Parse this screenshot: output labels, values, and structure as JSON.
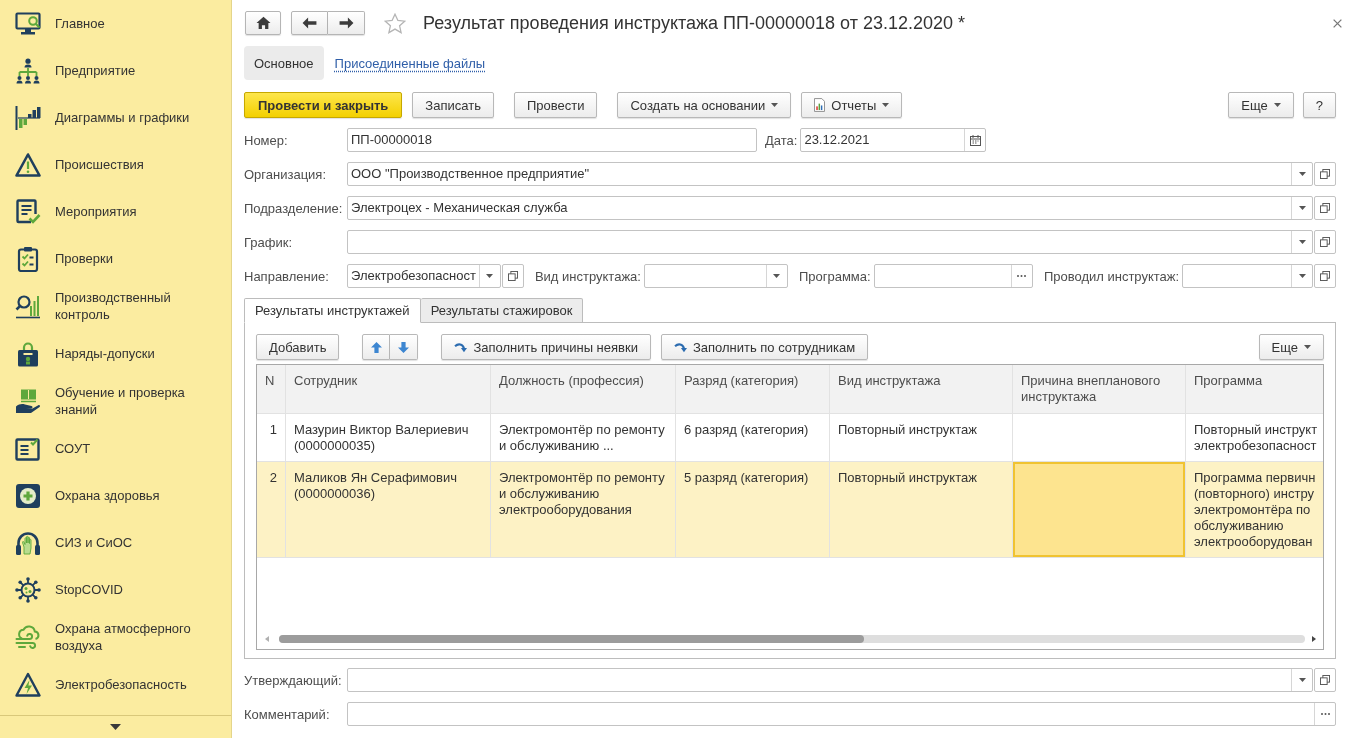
{
  "sidebar": {
    "items": [
      {
        "label": "Главное",
        "selected": false
      },
      {
        "label": "Предприятие",
        "selected": false
      },
      {
        "label": "Диаграммы и графики",
        "selected": false
      },
      {
        "label": "Происшествия",
        "selected": false
      },
      {
        "label": "Мероприятия",
        "selected": false
      },
      {
        "label": "Проверки",
        "selected": false
      },
      {
        "label": "Производственный контроль",
        "selected": false
      },
      {
        "label": "Наряды-допуски",
        "selected": false
      },
      {
        "label": "Обучение и проверка знаний",
        "selected": false
      },
      {
        "label": "СОУТ",
        "selected": false
      },
      {
        "label": "Охрана здоровья",
        "selected": false
      },
      {
        "label": "СИЗ и СиОС",
        "selected": false
      },
      {
        "label": "StopCOVID",
        "selected": false
      },
      {
        "label": "Охрана атмосферного воздуха",
        "selected": false
      },
      {
        "label": "Электробезопасность",
        "selected": false
      }
    ]
  },
  "header": {
    "title": "Результат проведения инструктажа ПП-00000018 от 23.12.2020 *"
  },
  "form_tabs": [
    {
      "label": "Основное",
      "selected": true
    },
    {
      "label": "Присоединенные файлы",
      "selected": false
    }
  ],
  "command_bar": {
    "buttons": [
      {
        "label": "Провести и закрыть",
        "kind": "default"
      },
      {
        "label": "Записать",
        "kind": "plain"
      },
      {
        "label": "Провести",
        "kind": "plain"
      },
      {
        "label": "Создать на основании",
        "kind": "menu"
      },
      {
        "label": "Отчеты",
        "kind": "reports"
      }
    ],
    "right_buttons": [
      {
        "label": "Еще",
        "kind": "menu"
      },
      {
        "label": "?",
        "kind": "plain"
      }
    ]
  },
  "fields": [
    [
      {
        "label": "Номер:",
        "value": "ПП-00000018",
        "kind": "text"
      },
      {
        "label": "Дата:",
        "value": "23.12.2021",
        "kind": "date"
      }
    ],
    [
      {
        "label": "Организация:",
        "value": "ООО \"Производственное предприятие\"",
        "kind": "reference"
      }
    ],
    [
      {
        "label": "Подразделение:",
        "value": "Электроцех - Механическая служба",
        "kind": "reference"
      }
    ],
    [
      {
        "label": "График:",
        "kind": "reference"
      }
    ],
    [
      {
        "label": "Направление:",
        "value": "Электробезопасност",
        "kind": "reference"
      },
      {
        "label": "Вид инструктажа:",
        "kind": "list"
      },
      {
        "label": "Программа:",
        "kind": "select"
      },
      {
        "label": "Проводил инструктаж:",
        "kind": "reference"
      }
    ]
  ],
  "tabs": [
    {
      "label": "Результаты инструктажей",
      "selected": true
    },
    {
      "label": "Результаты стажировок",
      "selected": false
    }
  ],
  "table_toolbar": {
    "buttons": [
      {
        "label": "Добавить",
        "kind": "plain"
      },
      {
        "kind": "up"
      },
      {
        "kind": "down"
      },
      {
        "label": "Заполнить причины неявки",
        "kind": "fill"
      },
      {
        "label": "Заполнить по сотрудникам",
        "kind": "fill"
      }
    ],
    "right_buttons": [
      {
        "label": "Еще",
        "kind": "menu"
      }
    ]
  },
  "table": {
    "columns": [
      "N",
      "Сотрудник",
      "Должность (профессия)",
      "Разряд (категория)",
      "Вид инструктажа",
      "Причина внепланового инструктажа",
      "Программа"
    ],
    "rows": [
      {
        "selected": false,
        "cells": [
          {
            "text": "1",
            "focused": false
          },
          {
            "text": "Мазурин Виктор Валериевич (0000000035)",
            "focused": false
          },
          {
            "text": "Электромонтёр по ремонту и обслуживанию ...",
            "focused": false
          },
          {
            "text": "6 разряд (категория)",
            "focused": false
          },
          {
            "text": "Повторный инструктаж",
            "focused": false
          },
          {
            "focused": false
          },
          {
            "text": "Повторный инструкт\nэлектробезопасност",
            "focused": false
          }
        ]
      },
      {
        "selected": true,
        "cells": [
          {
            "text": "2",
            "focused": false
          },
          {
            "text": "Маликов Ян Серафимович (0000000036)",
            "focused": false
          },
          {
            "text": "Электромонтёр по ремонту и обслуживанию электрооборудования",
            "focused": false
          },
          {
            "text": "5 разряд (категория)",
            "focused": false
          },
          {
            "text": "Повторный инструктаж",
            "focused": false
          },
          {
            "focused": true
          },
          {
            "text": "Программа первичн\n(повторного) инстру\nэлектромонтёра по\nобслуживанию\nэлектрооборудован",
            "focused": false
          }
        ]
      }
    ]
  },
  "footer_fields": [
    {
      "label": "Утверждающий:",
      "kind": "reference"
    },
    {
      "label": "Комментарий:",
      "kind": "select"
    }
  ]
}
